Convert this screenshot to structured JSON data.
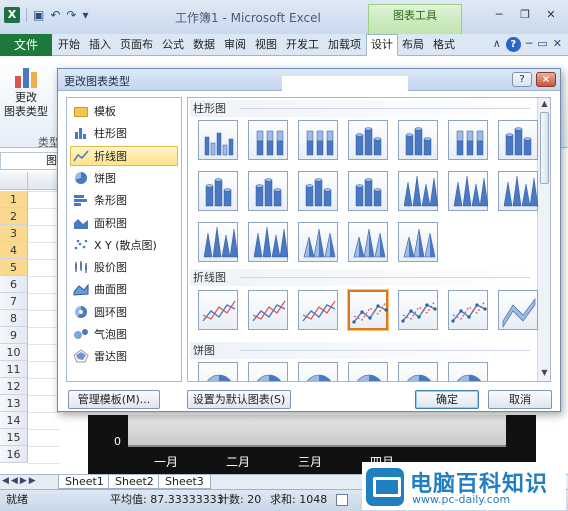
{
  "app": {
    "window_title": "工作簿1 - Microsoft Excel",
    "context_group": "图表工具",
    "file_tab": "文件",
    "tabs": [
      "开始",
      "插入",
      "页面布",
      "公式",
      "数据",
      "审阅",
      "视图",
      "开发工",
      "加载项",
      "设计",
      "布局",
      "格式"
    ],
    "active_tab": "设计"
  },
  "ribbon": {
    "change_chart_type_label1": "更改",
    "change_chart_type_label2": "图表类型",
    "group_label": "类型"
  },
  "formula": {
    "name_box": "图"
  },
  "rows": [
    "1",
    "2",
    "3",
    "4",
    "5",
    "6",
    "7",
    "8",
    "9",
    "10",
    "11",
    "12",
    "13",
    "14",
    "15",
    "16"
  ],
  "chart_bg": {
    "zero_label": "0",
    "categories": [
      "一月",
      "二月",
      "三月",
      "四月"
    ]
  },
  "sheet_tabs": [
    "Sheet1",
    "Sheet2",
    "Sheet3"
  ],
  "status": {
    "ready": "就绪",
    "average": "平均值: 87.33333333",
    "count": "计数: 20",
    "sum": "求和: 1048"
  },
  "dialog": {
    "title": "更改图表类型",
    "help": "?",
    "close": "×",
    "categories": [
      {
        "label": "模板",
        "icon": "folder-icon"
      },
      {
        "label": "柱形图",
        "icon": "column-chart-icon"
      },
      {
        "label": "折线图",
        "icon": "line-chart-icon"
      },
      {
        "label": "饼图",
        "icon": "pie-chart-icon"
      },
      {
        "label": "条形图",
        "icon": "bar-chart-icon"
      },
      {
        "label": "面积图",
        "icon": "area-chart-icon"
      },
      {
        "label": "X Y (散点图)",
        "icon": "scatter-chart-icon"
      },
      {
        "label": "股价图",
        "icon": "stock-chart-icon"
      },
      {
        "label": "曲面图",
        "icon": "surface-chart-icon"
      },
      {
        "label": "圆环图",
        "icon": "doughnut-chart-icon"
      },
      {
        "label": "气泡图",
        "icon": "bubble-chart-icon"
      },
      {
        "label": "雷达图",
        "icon": "radar-chart-icon"
      }
    ],
    "active_category": "折线图",
    "sections": [
      "柱形图",
      "折线图",
      "饼图"
    ],
    "buttons": {
      "manage_templates": "管理模板(M)...",
      "set_default": "设置为默认图表(S)",
      "ok": "确定",
      "cancel": "取消"
    }
  },
  "watermark": {
    "title": "电脑百科知识",
    "url": "www.pc-daily.com"
  },
  "colors": {
    "accent_blue": "#4a78c2",
    "selection_orange": "#e0761c",
    "file_tab_green": "#1d7a3c",
    "watermark_blue": "#1f7fc1"
  }
}
